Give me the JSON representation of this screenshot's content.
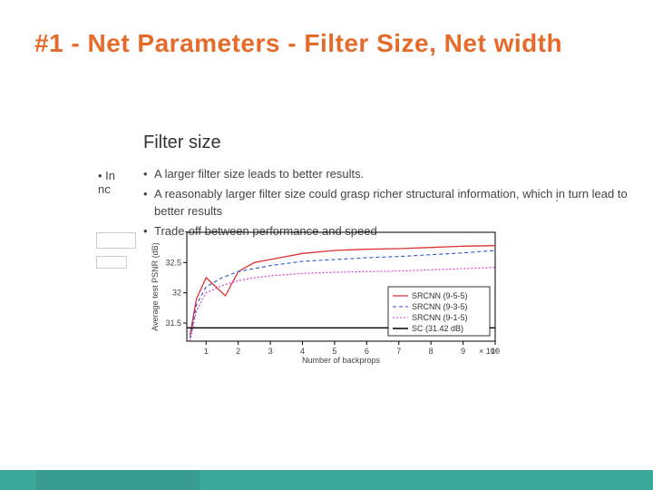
{
  "title": "#1 - Net Parameters - Filter Size, Net width",
  "subtitle": "Filter size",
  "bullets": [
    "A larger filter size leads to better results.",
    "A reasonably larger filter size could grasp richer structural information, which in turn lead to better results",
    "Trade-off between performance and speed"
  ],
  "bg_bullet_prefix": "• In",
  "bg_bullet_line2": "nc",
  "bg_frag_dot": ".",
  "chart_data": {
    "type": "line",
    "title": "",
    "xlabel": "Number of backprops",
    "ylabel": "Average test PSNR (dB)",
    "x_exponent_label": "× 10⁵",
    "xticks": [
      1,
      2,
      3,
      4,
      5,
      6,
      7,
      8,
      9,
      10
    ],
    "yticks": [
      31.5,
      32,
      32.5
    ],
    "xlim": [
      0.4,
      10
    ],
    "ylim": [
      31.2,
      33.0
    ],
    "series": [
      {
        "name": "SRCNN (9-5-5)",
        "style": "red",
        "x": [
          0.5,
          0.7,
          1,
          1.3,
          1.6,
          2,
          2.5,
          3,
          4,
          5,
          6,
          7,
          8,
          9,
          10
        ],
        "y": [
          31.3,
          31.9,
          32.25,
          32.1,
          31.95,
          32.35,
          32.5,
          32.55,
          32.65,
          32.7,
          32.72,
          32.73,
          32.75,
          32.77,
          32.78
        ]
      },
      {
        "name": "SRCNN (9-3-5)",
        "style": "blue",
        "x": [
          0.5,
          0.7,
          1,
          1.5,
          2,
          2.5,
          3,
          4,
          5,
          6,
          7,
          8,
          9,
          10
        ],
        "y": [
          31.25,
          31.8,
          32.1,
          32.25,
          32.35,
          32.4,
          32.45,
          32.52,
          32.55,
          32.58,
          32.6,
          32.63,
          32.66,
          32.7
        ]
      },
      {
        "name": "SRCNN (9-1-5)",
        "style": "magenta",
        "x": [
          0.5,
          0.7,
          1,
          1.5,
          2,
          2.5,
          3,
          4,
          5,
          6,
          7,
          8,
          9,
          10
        ],
        "y": [
          31.2,
          31.7,
          32.0,
          32.12,
          32.2,
          32.25,
          32.28,
          32.32,
          32.34,
          32.35,
          32.36,
          32.38,
          32.4,
          32.42
        ]
      },
      {
        "name": "SC (31.42 dB)",
        "style": "black",
        "x": [
          0.4,
          10
        ],
        "y": [
          31.42,
          31.42
        ]
      }
    ],
    "legend_position": "bottom-right",
    "grid": false
  }
}
